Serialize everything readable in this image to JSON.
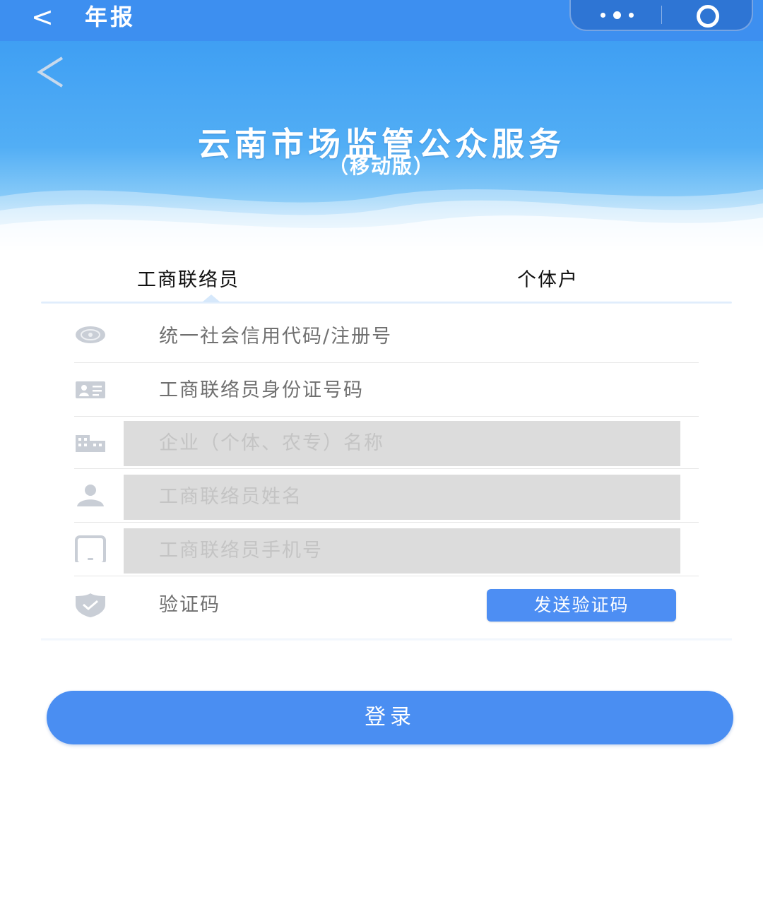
{
  "topbar": {
    "back_glyph": "<",
    "title": "年报",
    "more_icon": "more-dots-icon",
    "close_icon": "record-target-icon"
  },
  "banner": {
    "title": "云南市场监管公众服务",
    "subtitle": "（移动版）"
  },
  "tabs": [
    {
      "label": "工商联络员",
      "active": true
    },
    {
      "label": "个体户",
      "active": false
    }
  ],
  "form": {
    "credit_code": {
      "placeholder": "统一社会信用代码/注册号",
      "icon": "badge-seal-icon"
    },
    "id_number": {
      "placeholder": "工商联络员身份证号码",
      "icon": "id-card-icon"
    },
    "enterprise_name": {
      "placeholder": "企业（个体、农专）名称",
      "icon": "building-icon",
      "disabled": true
    },
    "contact_name": {
      "placeholder": "工商联络员姓名",
      "icon": "person-icon",
      "disabled": true
    },
    "phone": {
      "placeholder": "工商联络员手机号",
      "icon": "tablet-icon",
      "disabled": true
    },
    "verify_code": {
      "placeholder": "验证码",
      "icon": "shield-check-icon"
    },
    "send_code_label": "发送验证码"
  },
  "login_label": "登录",
  "colors": {
    "nav": "#3d8ff0",
    "primary_button": "#4a8ef2",
    "disabled_field": "#dcdcdc"
  }
}
